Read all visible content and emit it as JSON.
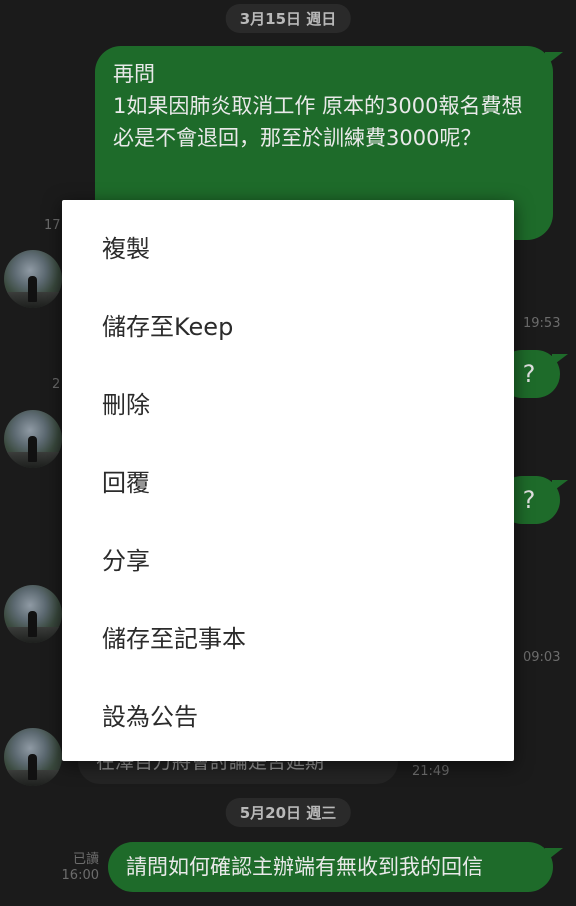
{
  "chat": {
    "date_top": "3月15日 週日",
    "date_bottom": "5月20日 週三",
    "messages": {
      "big_outgoing": "再問\n1如果因肺炎取消工作 原本的3000報名費想必是不會退回，那至於訓練費3000呢？",
      "question_mark_1": "?",
      "question_mark_2": "?",
      "partial_incoming": "在澤百万將會討論是否延期",
      "last_outgoing": "請問如何確認主辦端有無收到我的回信"
    },
    "times": {
      "t1": "19:53",
      "t2": "09:03",
      "t3": "21:49",
      "t4": "16:00",
      "left_partial_1": "17",
      "left_partial_2": "2"
    },
    "read_label": "已讀"
  },
  "context_menu": {
    "items": [
      "複製",
      "儲存至Keep",
      "刪除",
      "回覆",
      "分享",
      "儲存至記事本",
      "設為公告"
    ]
  },
  "colors": {
    "background": "#1b1b1b",
    "outgoing_bubble": "#1e6b2a",
    "menu_background": "#ffffff",
    "menu_text": "#2b2b2b"
  }
}
